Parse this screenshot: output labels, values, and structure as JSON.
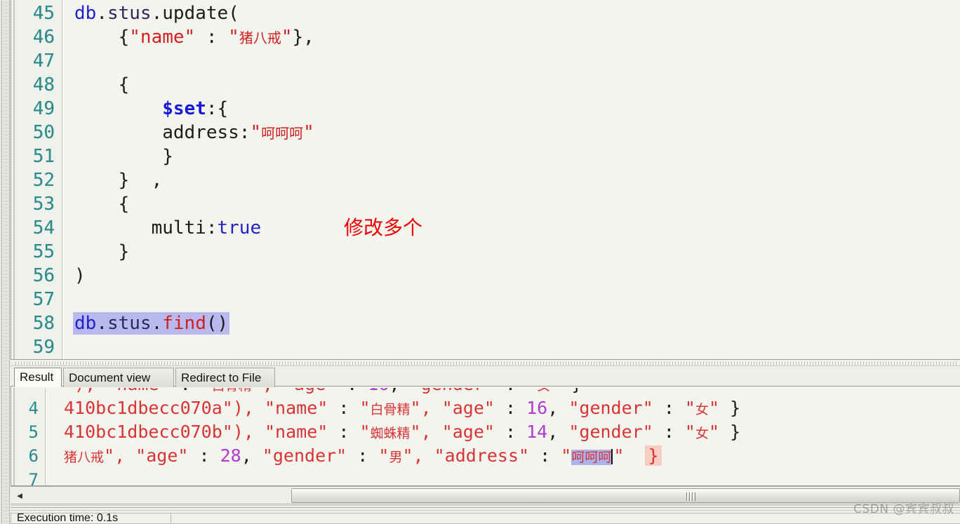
{
  "colors": {
    "editor_bg": "#f4f4ef",
    "gutter_bg": "#eff2ec",
    "line_number": "#2d8a8a",
    "keyword_blue": "#1818d8",
    "string_red": "#d02020",
    "result_string_red": "#d83434",
    "number_purple": "#b23ad0",
    "selection_lavender": "#b9b9ef",
    "selection_blue": "#aab4ea",
    "bracket_match_pink": "#f8cdc2",
    "annotation_red": "#ef0000"
  },
  "editor": {
    "name": "mongodb-shell-script-editor",
    "first_line_number": 45,
    "lines": [
      {
        "num": "45",
        "tokens": [
          {
            "t": "db",
            "c": "var-blue"
          },
          {
            "t": ".",
            "c": "punc"
          },
          {
            "t": "stus",
            "c": "id-dark"
          },
          {
            "t": ".",
            "c": "punc"
          },
          {
            "t": "update(",
            "c": "plain"
          }
        ]
      },
      {
        "num": "46",
        "tokens": [
          {
            "t": "    {",
            "c": "plain"
          },
          {
            "t": "\"name\"",
            "c": "str-red"
          },
          {
            "t": " : ",
            "c": "plain"
          },
          {
            "t": "\"",
            "c": "str-red"
          },
          {
            "t": "猪八戒",
            "c": "cjk-red"
          },
          {
            "t": "\"",
            "c": "str-red"
          },
          {
            "t": "},",
            "c": "plain"
          }
        ]
      },
      {
        "num": "47",
        "tokens": []
      },
      {
        "num": "48",
        "tokens": [
          {
            "t": "    {",
            "c": "plain"
          }
        ]
      },
      {
        "num": "49",
        "tokens": [
          {
            "t": "        ",
            "c": "plain"
          },
          {
            "t": "$set",
            "c": "kw-blue"
          },
          {
            "t": ":{",
            "c": "plain"
          }
        ]
      },
      {
        "num": "50",
        "tokens": [
          {
            "t": "        address:",
            "c": "plain"
          },
          {
            "t": "\"",
            "c": "str-red"
          },
          {
            "t": "呵呵呵",
            "c": "cjk-red"
          },
          {
            "t": "\"",
            "c": "str-red"
          }
        ]
      },
      {
        "num": "51",
        "tokens": [
          {
            "t": "        }",
            "c": "plain"
          }
        ]
      },
      {
        "num": "52",
        "tokens": [
          {
            "t": "    }  ,",
            "c": "plain"
          }
        ]
      },
      {
        "num": "53",
        "tokens": [
          {
            "t": "    {",
            "c": "plain"
          }
        ]
      },
      {
        "num": "54",
        "tokens": [
          {
            "t": "       multi:",
            "c": "plain"
          },
          {
            "t": "true",
            "c": "var-blue"
          }
        ]
      },
      {
        "num": "55",
        "tokens": [
          {
            "t": "    }",
            "c": "plain"
          }
        ]
      },
      {
        "num": "56",
        "tokens": [
          {
            "t": ")",
            "c": "plain"
          }
        ]
      },
      {
        "num": "57",
        "tokens": []
      },
      {
        "num": "58",
        "selected": true,
        "tokens": [
          {
            "t": "db",
            "c": "var-blue"
          },
          {
            "t": ".",
            "c": "punc"
          },
          {
            "t": "stus",
            "c": "id-dark"
          },
          {
            "t": ".",
            "c": "punc"
          },
          {
            "t": "find",
            "c": "str-red"
          },
          {
            "t": "()",
            "c": "punc"
          }
        ]
      },
      {
        "num": "59",
        "tokens": []
      }
    ],
    "annotation": {
      "text": "修改多个",
      "line_num": "54"
    }
  },
  "tabs": [
    {
      "label": "Result",
      "active": true
    },
    {
      "label": "Document view",
      "active": false
    },
    {
      "label": "Redirect to File",
      "active": false
    }
  ],
  "result": {
    "name": "query-result-output",
    "lines": [
      {
        "num": "4",
        "tokens": [
          {
            "t": "410bc1dbecc070a",
            "c": "str-red"
          },
          {
            "t": "\"), ",
            "c": "str-red"
          },
          {
            "t": "\"name\"",
            "c": "str-red"
          },
          {
            "t": " : ",
            "c": "punc"
          },
          {
            "t": "\"",
            "c": "str-red"
          },
          {
            "t": "白骨精",
            "c": "cjk-red"
          },
          {
            "t": "\", ",
            "c": "str-red"
          },
          {
            "t": "\"age\"",
            "c": "str-red"
          },
          {
            "t": " : ",
            "c": "punc"
          },
          {
            "t": "16",
            "c": "num-pur"
          },
          {
            "t": ", ",
            "c": "punc"
          },
          {
            "t": "\"gender\"",
            "c": "str-red"
          },
          {
            "t": " : ",
            "c": "punc"
          },
          {
            "t": "\"",
            "c": "str-red"
          },
          {
            "t": "女",
            "c": "cjk-red"
          },
          {
            "t": "\" ",
            "c": "str-red"
          },
          {
            "t": "}",
            "c": "punc"
          }
        ]
      },
      {
        "num": "5",
        "tokens": [
          {
            "t": "410bc1dbecc070b",
            "c": "str-red"
          },
          {
            "t": "\"), ",
            "c": "str-red"
          },
          {
            "t": "\"name\"",
            "c": "str-red"
          },
          {
            "t": " : ",
            "c": "punc"
          },
          {
            "t": "\"",
            "c": "str-red"
          },
          {
            "t": "蜘蛛精",
            "c": "cjk-red"
          },
          {
            "t": "\", ",
            "c": "str-red"
          },
          {
            "t": "\"age\"",
            "c": "str-red"
          },
          {
            "t": " : ",
            "c": "punc"
          },
          {
            "t": "14",
            "c": "num-pur"
          },
          {
            "t": ", ",
            "c": "punc"
          },
          {
            "t": "\"gender\"",
            "c": "str-red"
          },
          {
            "t": " : ",
            "c": "punc"
          },
          {
            "t": "\"",
            "c": "str-red"
          },
          {
            "t": "女",
            "c": "cjk-red"
          },
          {
            "t": "\" ",
            "c": "str-red"
          },
          {
            "t": "}",
            "c": "punc"
          }
        ]
      },
      {
        "num": "6",
        "tokens": [
          {
            "t": "猪八戒",
            "c": "cjk-red"
          },
          {
            "t": "\", ",
            "c": "str-red"
          },
          {
            "t": "\"age\"",
            "c": "str-red"
          },
          {
            "t": " : ",
            "c": "punc"
          },
          {
            "t": "28",
            "c": "num-pur"
          },
          {
            "t": ", ",
            "c": "punc"
          },
          {
            "t": "\"gender\"",
            "c": "str-red"
          },
          {
            "t": " : ",
            "c": "punc"
          },
          {
            "t": "\"",
            "c": "str-red"
          },
          {
            "t": "男",
            "c": "cjk-red"
          },
          {
            "t": "\", ",
            "c": "str-red"
          },
          {
            "t": "\"address\"",
            "c": "str-red"
          },
          {
            "t": " : ",
            "c": "punc"
          },
          {
            "t": "\"",
            "c": "str-red"
          },
          {
            "t": "呵呵呵",
            "c": "sel-blue"
          },
          {
            "t": "CARET",
            "c": "caret"
          },
          {
            "t": "\"  ",
            "c": "str-red"
          },
          {
            "t": "}",
            "c": "brace-pink"
          }
        ]
      },
      {
        "num": "7",
        "tokens": []
      }
    ]
  },
  "hscrollbar": {
    "left_arrow": "◄",
    "thumb_grip": "grip"
  },
  "statusbar": {
    "execution_time": "Execution time: 0.1s",
    "right_cell": ""
  },
  "watermark": "CSDN @宾宾叔叔"
}
